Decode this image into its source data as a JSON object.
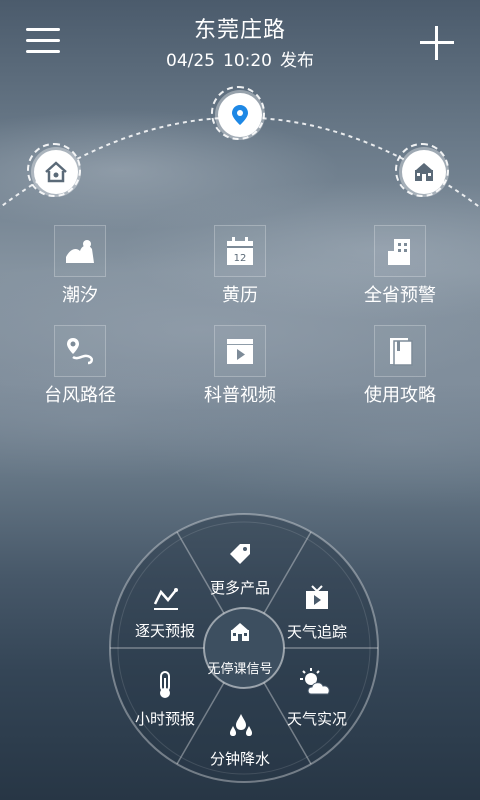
{
  "header": {
    "location_title": "东莞庄路",
    "publish_date": "04/25",
    "publish_time": "10:20",
    "publish_suffix": "发布",
    "menu_icon": "hamburger-menu-icon",
    "add_icon": "plus-icon"
  },
  "arc_nodes": [
    {
      "icon": "home-icon"
    },
    {
      "icon": "location-pin-icon",
      "selected": true
    },
    {
      "icon": "school-icon"
    }
  ],
  "tiles": [
    {
      "label": "潮汐",
      "icon": "tide-wave-icon"
    },
    {
      "label": "黄历",
      "icon": "calendar-icon",
      "badge": "12"
    },
    {
      "label": "全省预警",
      "icon": "buildings-icon"
    },
    {
      "label": "台风路径",
      "icon": "typhoon-route-icon"
    },
    {
      "label": "科普视频",
      "icon": "video-clapper-icon"
    },
    {
      "label": "使用攻略",
      "icon": "guide-book-icon"
    }
  ],
  "wheel": {
    "center_label": "无停课信号",
    "center_icon": "school-icon",
    "segments": [
      {
        "label": "更多产品",
        "icon": "tag-icon"
      },
      {
        "label": "天气追踪",
        "icon": "tv-icon"
      },
      {
        "label": "天气实况",
        "icon": "sun-cloud-icon"
      },
      {
        "label": "分钟降水",
        "icon": "raindrops-icon"
      },
      {
        "label": "小时预报",
        "icon": "thermometer-icon"
      },
      {
        "label": "逐天预报",
        "icon": "trend-line-icon"
      }
    ]
  },
  "colors": {
    "accent": "#1e88e5",
    "text": "#ffffff"
  }
}
